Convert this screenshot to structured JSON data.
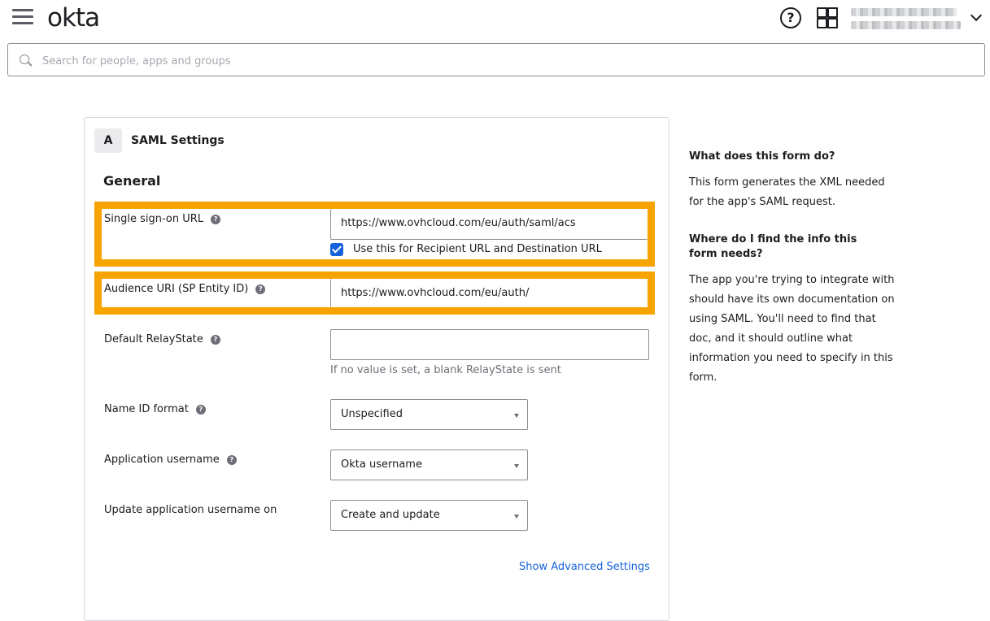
{
  "header": {
    "logo": "okta",
    "help_glyph": "?",
    "icons": {
      "menu": "hamburger-menu-icon",
      "help": "help-circle-icon",
      "apps": "app-grid-icon",
      "user_menu": "chevron-down-icon"
    }
  },
  "search": {
    "placeholder": "Search for people, apps and groups"
  },
  "form": {
    "step_letter": "A",
    "title": "SAML Settings",
    "section": "General",
    "help_glyph": "?",
    "sso_url": {
      "label": "Single sign-on URL",
      "value": "https://www.ovhcloud.com/eu/auth/saml/acs"
    },
    "recipient_checkbox": {
      "label": "Use this for Recipient URL and Destination URL",
      "checked": true
    },
    "audience_uri": {
      "label": "Audience URI (SP Entity ID)",
      "value": "https://www.ovhcloud.com/eu/auth/"
    },
    "relay_state": {
      "label": "Default RelayState",
      "value": "",
      "hint": "If no value is set, a blank RelayState is sent"
    },
    "name_id_format": {
      "label": "Name ID format",
      "value": "Unspecified"
    },
    "app_username": {
      "label": "Application username",
      "value": "Okta username"
    },
    "update_username": {
      "label": "Update application username on",
      "value": "Create and update"
    },
    "advanced_link": "Show Advanced Settings",
    "highlight_color": "#f7a400"
  },
  "side_help": {
    "q1": "What does this form do?",
    "a1": "This form generates the XML needed for the app's SAML request.",
    "q2": "Where do I find the info this form needs?",
    "a2": "The app you're trying to integrate with should have its own documentation on using SAML. You'll need to find that doc, and it should outline what information you need to specify in this form."
  }
}
